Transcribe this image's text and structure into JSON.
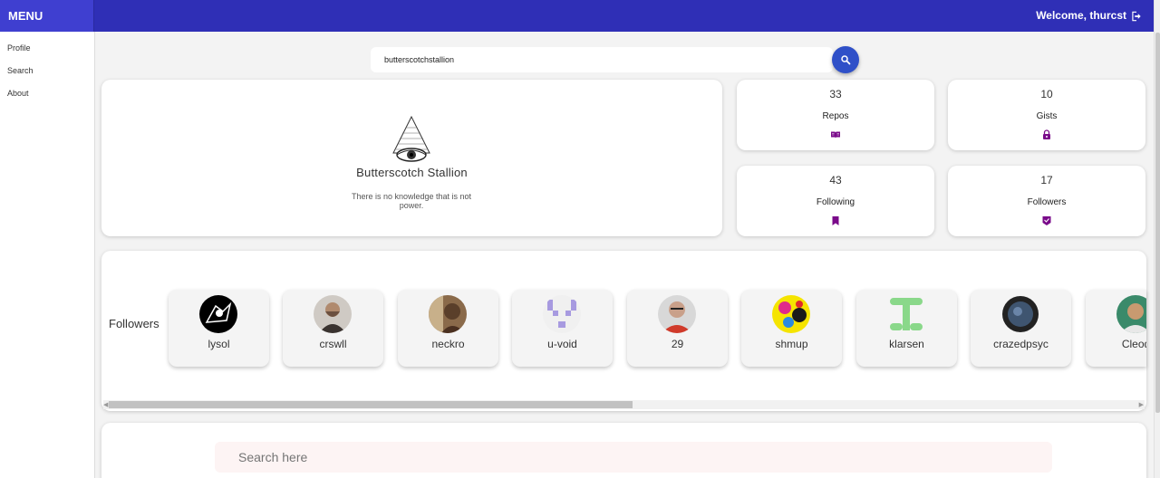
{
  "menu": {
    "title": "MENU",
    "items": [
      {
        "label": "Profile"
      },
      {
        "label": "Search"
      },
      {
        "label": "About"
      }
    ]
  },
  "header": {
    "welcome_text": "Welcome, thurcst",
    "brand_color": "#2f2fb6"
  },
  "search": {
    "value": "butterscotchstallion"
  },
  "profile": {
    "name": "Butterscotch Stallion",
    "bio": "There is no knowledge that is not power."
  },
  "stats": [
    {
      "value": "33",
      "label": "Repos",
      "icon": "book-icon"
    },
    {
      "value": "10",
      "label": "Gists",
      "icon": "lock-icon"
    },
    {
      "value": "43",
      "label": "Following",
      "icon": "bookmark-icon"
    },
    {
      "value": "17",
      "label": "Followers",
      "icon": "shield-check-icon"
    }
  ],
  "followers_section": {
    "title": "Followers",
    "items": [
      {
        "name": "lysol"
      },
      {
        "name": "crswll"
      },
      {
        "name": "neckro"
      },
      {
        "name": "u-void"
      },
      {
        "name": "29"
      },
      {
        "name": "shmup"
      },
      {
        "name": "klarsen"
      },
      {
        "name": "crazedpsyc"
      },
      {
        "name": "Cleod"
      }
    ]
  },
  "bottom_search": {
    "placeholder": "Search here"
  },
  "accent_color": "#7a0a8a"
}
